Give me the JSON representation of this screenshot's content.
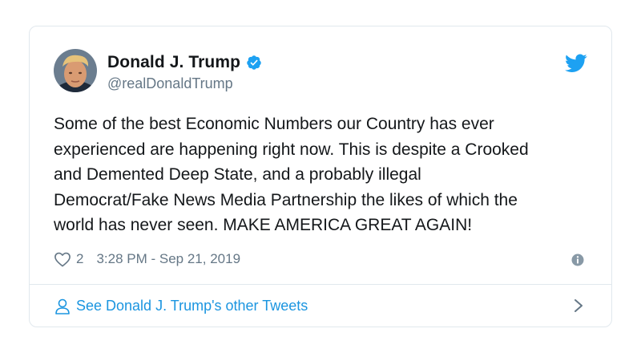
{
  "user": {
    "name": "Donald J. Trump",
    "handle": "@realDonaldTrump",
    "verified": true,
    "avatar_icon": "avatar-photo"
  },
  "tweet": {
    "lines": [
      "Some of the best Economic Numbers our Country has ever",
      "experienced are happening right now. This is despite a Crooked",
      "and Demented Deep State, and a probably illegal",
      "Democrat/Fake News Media Partnership the likes of which the",
      "world has never seen. MAKE AMERICA GREAT AGAIN!"
    ],
    "likes": "2",
    "timestamp": "3:28 PM - Sep 21, 2019"
  },
  "footer": {
    "link_text": "See Donald J. Trump's other Tweets"
  },
  "icons": {
    "brand": "twitter-bird-icon",
    "verified": "verified-badge-icon",
    "like": "heart-icon",
    "info": "info-icon",
    "person": "person-icon",
    "chevron": "chevron-right-icon"
  },
  "colors": {
    "brand_blue": "#1da1f2",
    "link_blue": "#1b95e0",
    "secondary_text": "#657786",
    "border": "#e1e8ed"
  }
}
